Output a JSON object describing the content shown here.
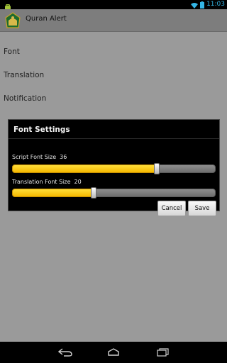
{
  "status_bar": {
    "time": "11:03",
    "wifi_icon": "wifi-icon",
    "battery_icon": "battery-icon",
    "notification_icon": "android-notification-icon"
  },
  "action_bar": {
    "title": "Quran Alert",
    "icon": "quran-alert-app-icon"
  },
  "settings": {
    "items": [
      "Font",
      "Translation",
      "Notification"
    ]
  },
  "dialog": {
    "title": "Font Settings",
    "script": {
      "label": "Script Font Size",
      "value": "36",
      "level": 0.71
    },
    "translation": {
      "label": "Translation Font Size",
      "value": "20",
      "level": 0.4
    },
    "cancel_label": "Cancel",
    "save_label": "Save"
  },
  "nav": {
    "back_icon": "back-icon",
    "home_icon": "home-icon",
    "recents_icon": "recents-icon"
  },
  "colors": {
    "accent": "#33b5e5",
    "seek_fill": "#ffcc00",
    "background": "#9a9a9a"
  }
}
